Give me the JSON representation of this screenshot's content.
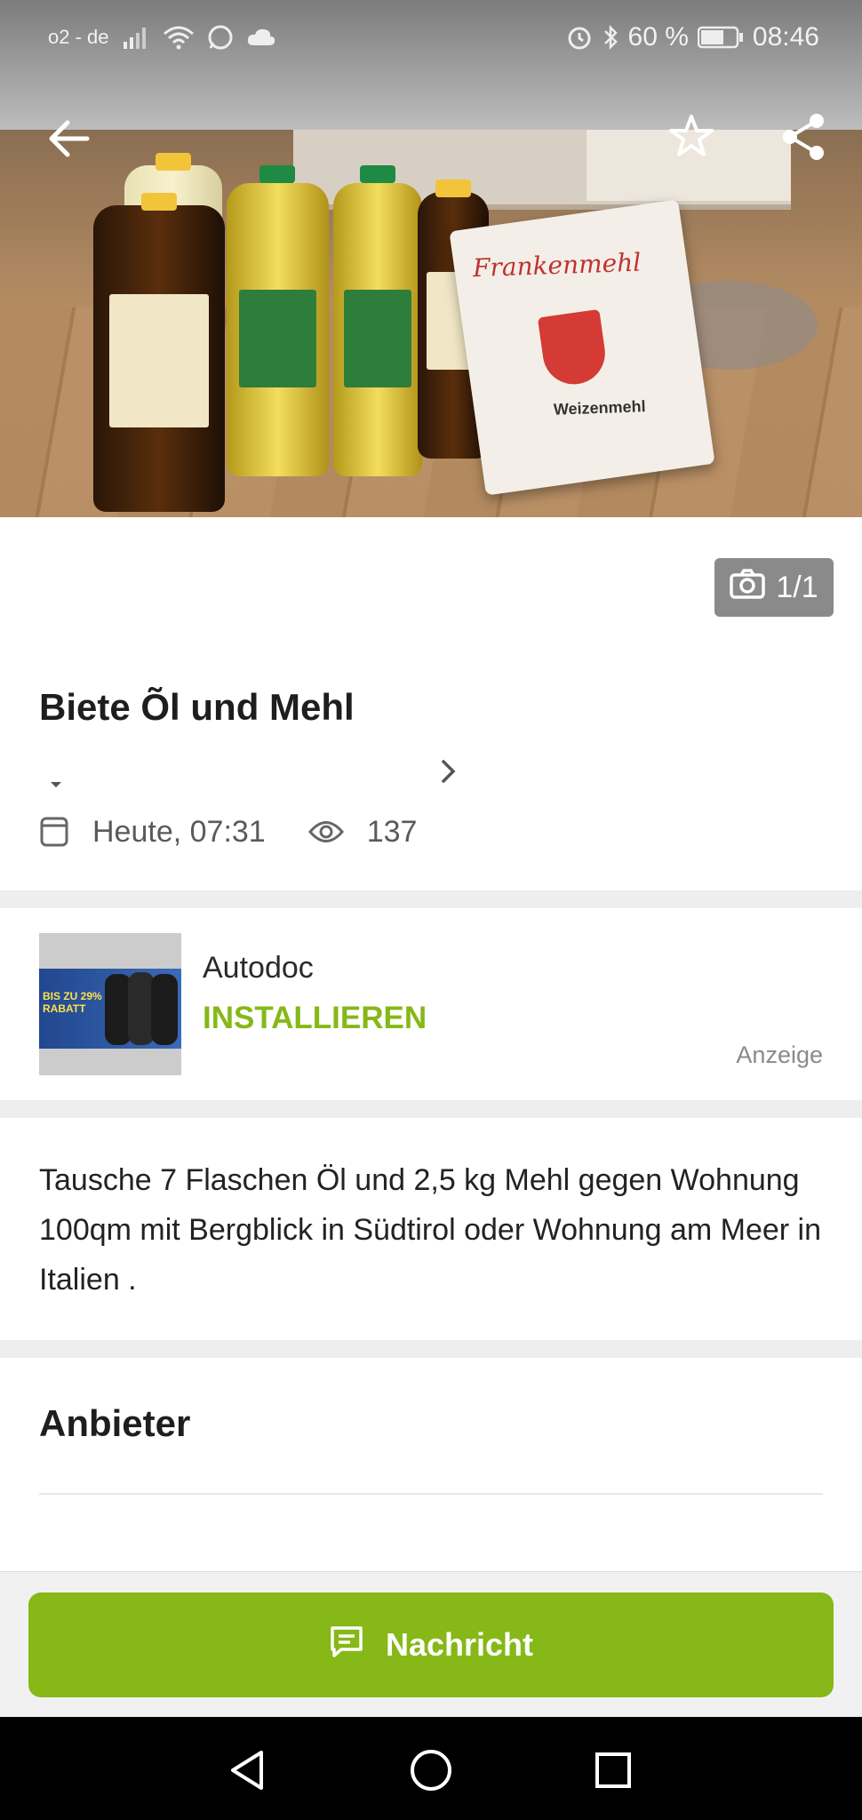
{
  "status_bar": {
    "carrier": "o2 - de",
    "battery_percent": "60 %",
    "time": "08:46",
    "icons": [
      "signal-icon",
      "wifi-icon",
      "whatsapp-icon",
      "cloud-icon",
      "alarm-icon",
      "bluetooth-icon",
      "battery-icon"
    ]
  },
  "header": {
    "back_icon": "arrow-left-icon",
    "favorite_icon": "star-outline-icon",
    "share_icon": "share-icon"
  },
  "hero": {
    "flour_brand": "Frankenmehl",
    "flour_type": "Weizenmehl"
  },
  "photo_counter": {
    "icon": "camera-icon",
    "text": "1/1"
  },
  "listing": {
    "title": "Biete Õl und Mehl",
    "date": "Heute, 07:31",
    "views": "137"
  },
  "ad": {
    "title": "Autodoc",
    "cta": "INSTALLIEREN",
    "label": "Anzeige",
    "thumb_text": "BIS ZU 29% RABATT"
  },
  "description": "Tausche 7 Flaschen Öl und 2,5 kg Mehl gegen Wohnung 100qm mit Bergblick in Südtirol oder Wohnung am Meer in Italien .",
  "seller_section": {
    "title": "Anbieter"
  },
  "action": {
    "message_label": "Nachricht",
    "icon": "chat-icon"
  },
  "nav": [
    "back-triangle-icon",
    "home-circle-icon",
    "recents-square-icon"
  ],
  "colors": {
    "accent": "#86b817",
    "counter_bg": "#8a8a8a"
  }
}
